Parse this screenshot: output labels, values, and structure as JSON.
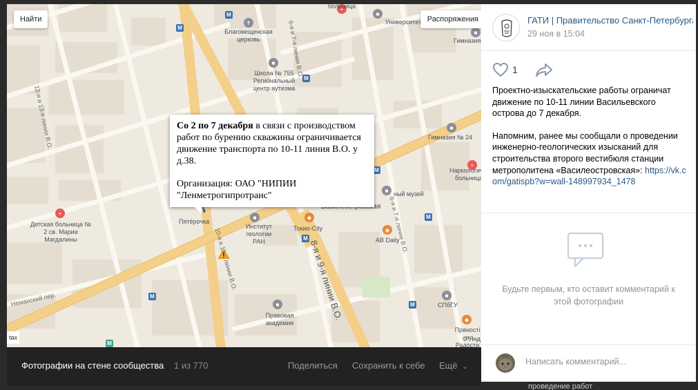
{
  "map": {
    "find_button": "Найти",
    "layout_button": "Распоряжения",
    "corner_tag": "tax",
    "copyright": "© Янд",
    "popup": {
      "bold": "Со 2 по 7 декабря",
      "text": " в связи с производством работ по бурению скважины ограничивается движение транспорта по 10-11 линия В.О. у д.38.",
      "org": "Организация: ОАО \"НИПИИ \"Ленметрогипротранс\""
    },
    "labels": [
      "больница",
      "Университет МВД",
      "Благовещенская церковь",
      "Гимназия",
      "Школа № 755 Региональный центр аутизма",
      "Гимназия № 24",
      "Наркологиче... больница",
      "Детская больница № 2 св. Марии Магдалины",
      "Пятёрочка",
      "Институт геологии РАН",
      "Токио-City",
      "Василеостровская",
      "ный музей",
      "AB Daily",
      "Правовая академия",
      "СПбГУ",
      "Пряності и Радости"
    ],
    "streets": [
      "12-я и 13-я линии В.О.",
      "6-я и 7-я линии В.О.",
      "10-я и 11-я линии В.О.",
      "8-я и 9-я линии В.О.",
      "6-я и 7-я линии В.О.",
      "Неманский пер."
    ]
  },
  "bottom_bar": {
    "title": "Фотографии на стене сообщества",
    "count": "1 из 770",
    "share": "Поделиться",
    "save": "Сохранить к себе",
    "more": "Ещё"
  },
  "post": {
    "author": "ГАТИ | Правительство Санкт-Петербурга",
    "date": "29 ноя в 15:04",
    "likes": "1",
    "text_p1": "Проектно-изыскательские работы ограничат движение по 10-11 линии Васильевского острова до 7 декабря.",
    "text_p2": "Напомним, ранее мы сообщали о проведении инженерно-геологических изысканий для строительства второго вестибюля станции метрополитена «Василеостровская»:",
    "link": "https://vk.com/gatispb?w=wall-148997934_1478",
    "empty_comments": "Будьте первым, кто оставит комментарий к этой фотографии",
    "comment_placeholder": "Написать комментарий..."
  },
  "under_text": "проведение работ",
  "colors": {
    "link": "#2a5885",
    "muted": "#939393",
    "road_major": "#f3cf8a",
    "metro": "#3a6fb0",
    "hospital": "#e85a55",
    "shop": "#e8883a",
    "bg_dark": "#2b2b2b"
  }
}
